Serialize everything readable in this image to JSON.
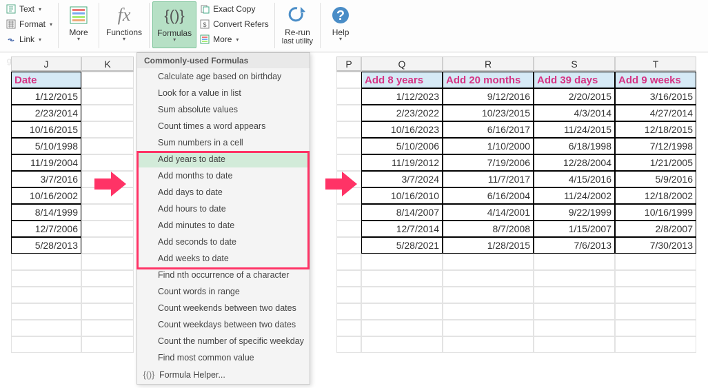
{
  "ribbon": {
    "text_label": "Text",
    "format_label": "Format",
    "link_label": "Link",
    "more1_label": "More",
    "functions_label": "Functions",
    "formulas_label": "Formulas",
    "exact_copy_label": "Exact Copy",
    "convert_refers_label": "Convert Refers",
    "more2_label": "More",
    "rerun_label": "Re-run",
    "rerun_label2": "last utility",
    "help_label": "Help"
  },
  "dropdown": {
    "title": "Commonly-used Formulas",
    "items": [
      "Calculate age based on birthday",
      "Look for a value in list",
      "Sum absolute values",
      "Count times a word appears",
      "Sum numbers in a cell",
      "Add years to date",
      "Add months to date",
      "Add days to date",
      "Add hours to date",
      "Add minutes to date",
      "Add seconds to date",
      "Add weeks to date",
      "Find nth occurrence of a character",
      "Count words in range",
      "Count weekends between two dates",
      "Count weekdays between two dates",
      "Count the number of specific weekday",
      "Find most common value"
    ],
    "helper_label": "Formula Helper..."
  },
  "columns": [
    "J",
    "K",
    "P",
    "Q",
    "R",
    "S",
    "T"
  ],
  "table_left": {
    "header": "Date",
    "rows": [
      "1/12/2015",
      "2/23/2014",
      "10/16/2015",
      "5/10/1998",
      "11/19/2004",
      "3/7/2016",
      "10/16/2002",
      "8/14/1999",
      "12/7/2006",
      "5/28/2013"
    ]
  },
  "table_right": {
    "headers": [
      "Add 8 years",
      "Add 20 months",
      "Add 39 days",
      "Add 9 weeks"
    ],
    "rows": [
      [
        "1/12/2023",
        "9/12/2016",
        "2/20/2015",
        "3/16/2015"
      ],
      [
        "2/23/2022",
        "10/23/2015",
        "4/3/2014",
        "4/27/2014"
      ],
      [
        "10/16/2023",
        "6/16/2017",
        "11/24/2015",
        "12/18/2015"
      ],
      [
        "5/10/2006",
        "1/10/2000",
        "6/18/1998",
        "7/12/1998"
      ],
      [
        "11/19/2012",
        "7/19/2006",
        "12/28/2004",
        "1/21/2005"
      ],
      [
        "3/7/2024",
        "11/7/2017",
        "4/15/2016",
        "5/9/2016"
      ],
      [
        "10/16/2010",
        "6/16/2004",
        "11/24/2002",
        "12/18/2002"
      ],
      [
        "8/14/2007",
        "4/14/2001",
        "9/22/1999",
        "10/16/1999"
      ],
      [
        "12/7/2014",
        "8/7/2008",
        "1/15/2007",
        "2/8/2007"
      ],
      [
        "5/28/2021",
        "1/28/2015",
        "7/6/2013",
        "7/30/2013"
      ]
    ]
  },
  "watermark": "g"
}
